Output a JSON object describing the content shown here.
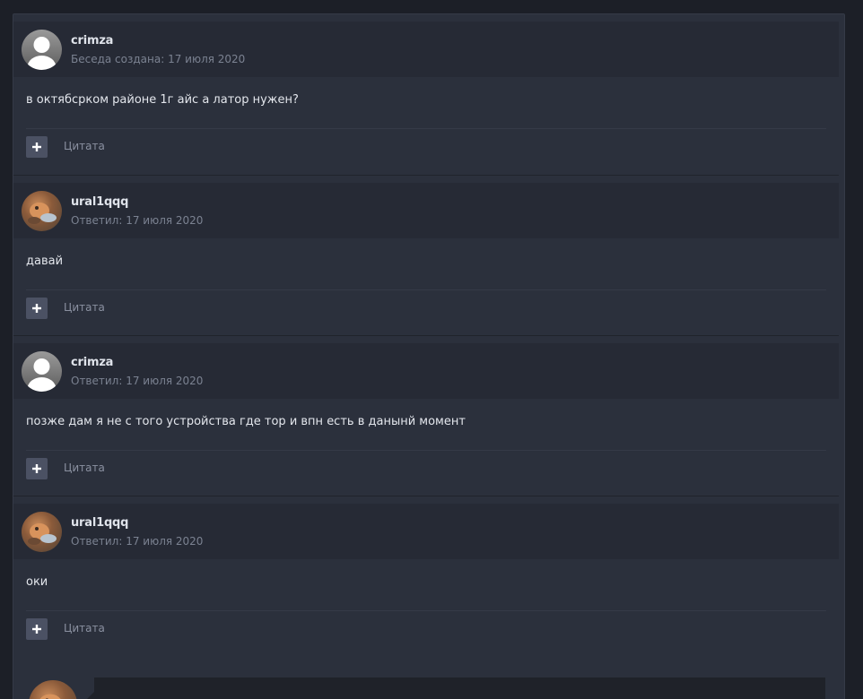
{
  "thread": {
    "quote_label": "Цитата",
    "messages": [
      {
        "author": "crimza",
        "meta": "Беседа создана: 17 июля 2020",
        "avatar": "default-avatar",
        "body": "в октябсрком районе 1г айс а латор нужен?"
      },
      {
        "author": "ural1qqq",
        "meta": "Ответил: 17 июля 2020",
        "avatar": "photo-avatar",
        "body": "давай"
      },
      {
        "author": "crimza",
        "meta": "Ответил: 17 июля 2020",
        "avatar": "default-avatar",
        "body": "позже дам я не с того устройства где тор и впн есть в данынй момент"
      },
      {
        "author": "ural1qqq",
        "meta": "Ответил: 17 июля 2020",
        "avatar": "photo-avatar",
        "body": "оки"
      }
    ]
  },
  "colors": {
    "page_bg": "#1c1f27",
    "panel_bg": "#2b303c",
    "header_bg": "#262a35",
    "text": "#e3e6ec",
    "muted": "#7b8291",
    "button": "#4b5163"
  }
}
